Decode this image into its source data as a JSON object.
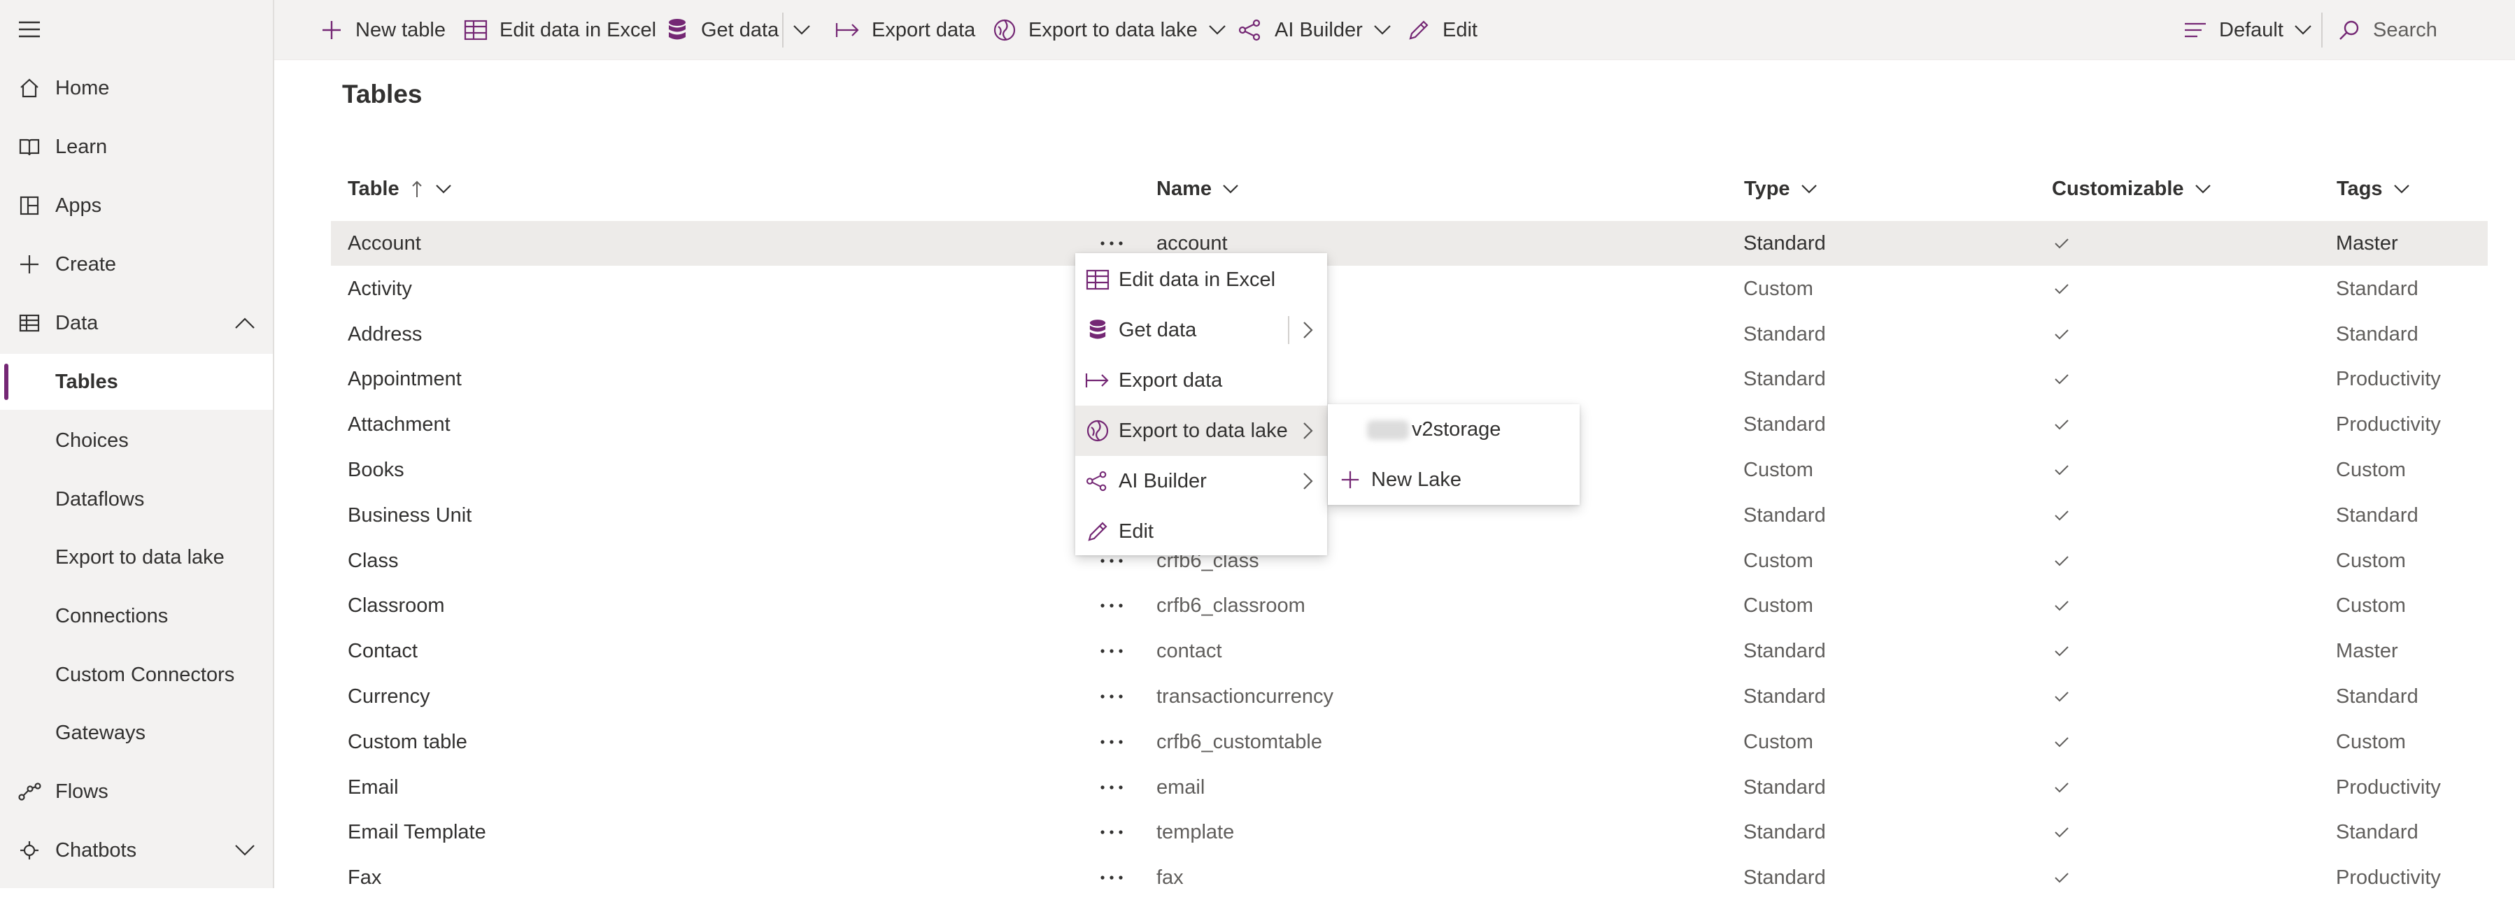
{
  "nav": {
    "items": [
      {
        "label": "Home",
        "icon": "home-icon"
      },
      {
        "label": "Learn",
        "icon": "book-icon"
      },
      {
        "label": "Apps",
        "icon": "apps-icon"
      },
      {
        "label": "Create",
        "icon": "plus-icon"
      },
      {
        "label": "Data",
        "icon": "table-icon",
        "expanded": true
      },
      {
        "label": "Tables",
        "selected": true
      },
      {
        "label": "Choices"
      },
      {
        "label": "Dataflows"
      },
      {
        "label": "Export to data lake"
      },
      {
        "label": "Connections"
      },
      {
        "label": "Custom Connectors"
      },
      {
        "label": "Gateways"
      },
      {
        "label": "Flows",
        "icon": "flow-icon"
      },
      {
        "label": "Chatbots",
        "icon": "chatbot-icon",
        "expanded": false
      }
    ]
  },
  "toolbar": {
    "new_table": "New table",
    "edit_excel": "Edit data in Excel",
    "get_data": "Get data",
    "export_data": "Export data",
    "export_lake": "Export to data lake",
    "ai_builder": "AI Builder",
    "edit": "Edit",
    "view": "Default",
    "search_placeholder": "Search"
  },
  "page": {
    "title": "Tables"
  },
  "table": {
    "headers": {
      "table": "Table",
      "name": "Name",
      "type": "Type",
      "customizable": "Customizable",
      "tags": "Tags"
    },
    "sort_column": "Table",
    "sort_direction": "ascending",
    "rows": [
      {
        "table": "Account",
        "name": "account",
        "type": "Standard",
        "customizable": true,
        "tags": "Master"
      },
      {
        "table": "Activity",
        "name": "",
        "type": "Custom",
        "customizable": true,
        "tags": "Standard"
      },
      {
        "table": "Address",
        "name": "",
        "type": "Standard",
        "customizable": true,
        "tags": "Standard"
      },
      {
        "table": "Appointment",
        "name": "",
        "type": "Standard",
        "customizable": true,
        "tags": "Productivity"
      },
      {
        "table": "Attachment",
        "name": "",
        "type": "Standard",
        "customizable": true,
        "tags": "Productivity"
      },
      {
        "table": "Books",
        "name": "",
        "type": "Custom",
        "customizable": true,
        "tags": "Custom"
      },
      {
        "table": "Business Unit",
        "name": "",
        "type": "Standard",
        "customizable": true,
        "tags": "Standard"
      },
      {
        "table": "Class",
        "name": "crfb6_class",
        "type": "Custom",
        "customizable": true,
        "tags": "Custom"
      },
      {
        "table": "Classroom",
        "name": "crfb6_classroom",
        "type": "Custom",
        "customizable": true,
        "tags": "Custom"
      },
      {
        "table": "Contact",
        "name": "contact",
        "type": "Standard",
        "customizable": true,
        "tags": "Master"
      },
      {
        "table": "Currency",
        "name": "transactioncurrency",
        "type": "Standard",
        "customizable": true,
        "tags": "Standard"
      },
      {
        "table": "Custom table",
        "name": "crfb6_customtable",
        "type": "Custom",
        "customizable": true,
        "tags": "Custom"
      },
      {
        "table": "Email",
        "name": "email",
        "type": "Standard",
        "customizable": true,
        "tags": "Productivity"
      },
      {
        "table": "Email Template",
        "name": "template",
        "type": "Standard",
        "customizable": true,
        "tags": "Standard"
      },
      {
        "table": "Fax",
        "name": "fax",
        "type": "Standard",
        "customizable": true,
        "tags": "Productivity"
      }
    ]
  },
  "context_menu": {
    "items": [
      {
        "label": "Edit data in Excel",
        "icon": "excel-icon"
      },
      {
        "label": "Get data",
        "icon": "database-icon",
        "split": true
      },
      {
        "label": "Export data",
        "icon": "export-icon"
      },
      {
        "label": "Export to data lake",
        "icon": "data-lake-icon",
        "submenu": true,
        "active": true
      },
      {
        "label": "AI Builder",
        "icon": "ai-builder-icon",
        "submenu": true
      },
      {
        "label": "Edit",
        "icon": "pencil-icon"
      }
    ]
  },
  "submenu": {
    "storage_label": "v2storage",
    "new_lake": "New Lake"
  },
  "colors": {
    "accent": "#742774",
    "nav_bg": "#f3f2f1",
    "hover_row": "#edebe9"
  }
}
